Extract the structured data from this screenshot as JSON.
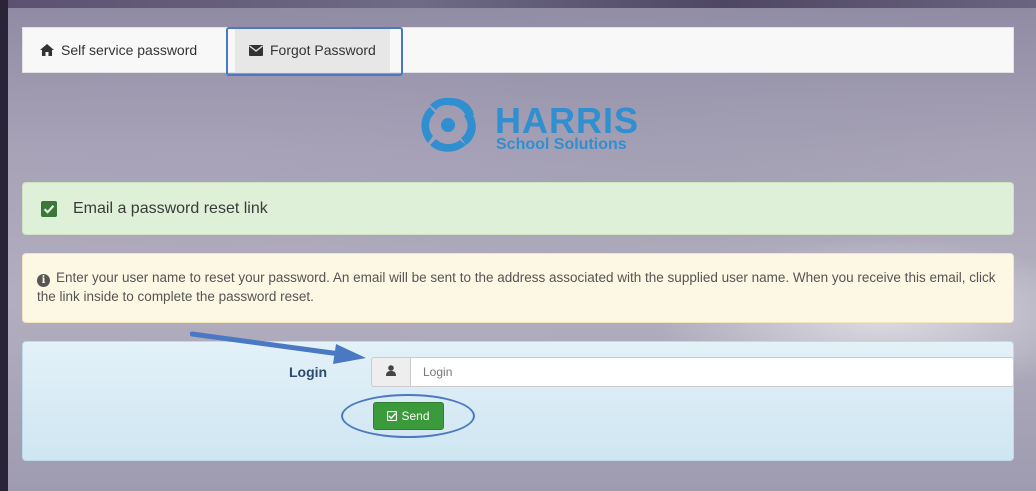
{
  "page_header": {
    "title_fragment": "p"
  },
  "navbar": {
    "items": [
      {
        "label": "Self service password",
        "icon": "home-icon"
      },
      {
        "label": "Forgot Password",
        "icon": "envelope-icon",
        "active": true
      }
    ]
  },
  "logo": {
    "brand": "HARRIS",
    "tagline": "School Solutions",
    "color": "#2f8fd0"
  },
  "success_alert": {
    "icon": "check-square-icon",
    "text": "Email a password reset link"
  },
  "info_alert": {
    "icon": "info-circle-icon",
    "text": "Enter your user name to reset your password. An email will be sent to the address associated with the supplied user name. When you receive this email, click the link inside to complete the password reset."
  },
  "form": {
    "login_label": "Login",
    "login_icon": "user-icon",
    "login_placeholder": "Login",
    "login_value": "",
    "send_label": "Send",
    "send_icon": "check-square-icon"
  },
  "colors": {
    "accent": "#4a78c2",
    "success": "#3b9a3b",
    "link": "#2f8fd0"
  }
}
